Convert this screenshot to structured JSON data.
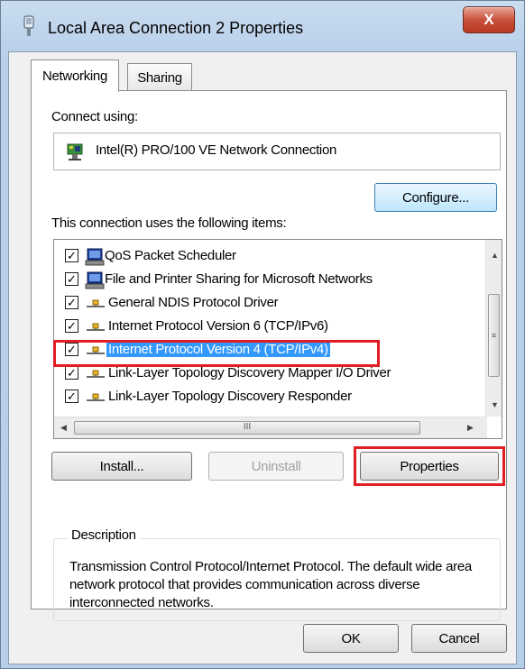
{
  "window": {
    "title": "Local Area Connection 2 Properties",
    "close_label": "X"
  },
  "tabs": [
    {
      "label": "Networking",
      "active": true
    },
    {
      "label": "Sharing",
      "active": false
    }
  ],
  "networking": {
    "connect_using_label": "Connect using:",
    "adapter_name": "Intel(R) PRO/100 VE Network Connection",
    "configure_label": "Configure...",
    "items_label": "This connection uses the following items:",
    "items": [
      {
        "label": "QoS Packet Scheduler",
        "checked": true,
        "icon": "network-client-icon"
      },
      {
        "label": "File and Printer Sharing for Microsoft Networks",
        "checked": true,
        "icon": "network-client-icon"
      },
      {
        "label": "General NDIS Protocol Driver",
        "checked": true,
        "icon": "protocol-icon"
      },
      {
        "label": "Internet Protocol Version 6 (TCP/IPv6)",
        "checked": true,
        "icon": "protocol-icon"
      },
      {
        "label": "Internet Protocol Version 4 (TCP/IPv4)",
        "checked": true,
        "icon": "protocol-icon",
        "selected": true
      },
      {
        "label": "Link-Layer Topology Discovery Mapper I/O Driver",
        "checked": true,
        "icon": "protocol-icon"
      },
      {
        "label": "Link-Layer Topology Discovery Responder",
        "checked": true,
        "icon": "protocol-icon"
      }
    ],
    "scroll_grip": "III",
    "install_label": "Install...",
    "uninstall_label": "Uninstall",
    "properties_label": "Properties",
    "description_title": "Description",
    "description_text": "Transmission Control Protocol/Internet Protocol. The default wide area network protocol that provides communication across diverse interconnected networks."
  },
  "footer": {
    "ok_label": "OK",
    "cancel_label": "Cancel"
  },
  "colors": {
    "selection": "#3399ff",
    "highlight_box": "#e01e24"
  }
}
